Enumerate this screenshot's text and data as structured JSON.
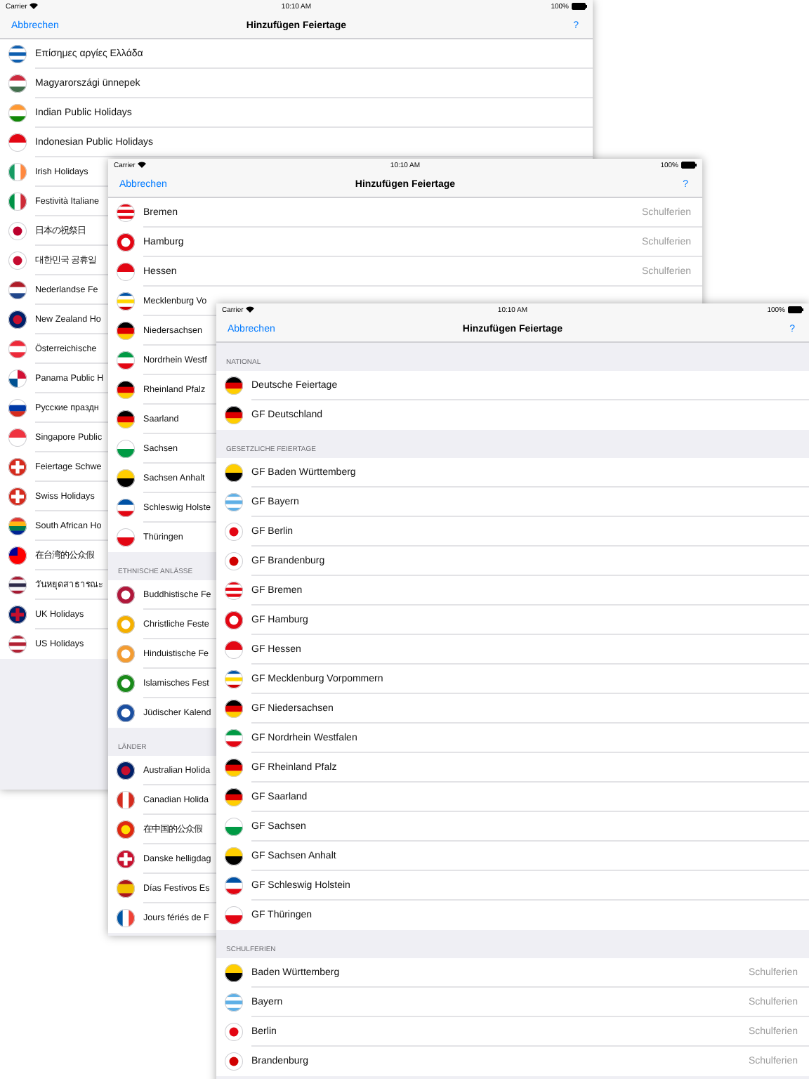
{
  "windows": [
    {
      "status_bar": {
        "carrier": "Carrier",
        "time": "10:10 AM",
        "battery": "100%"
      },
      "nav": {
        "cancel": "Abbrechen",
        "title": "Hinzufügen Feiertage",
        "help": "?"
      },
      "sections": [
        {
          "rows": [
            {
              "label": "Επίσημες αργίες Ελλάδα"
            },
            {
              "label": "Magyarországi ünnepek"
            },
            {
              "label": "Indian Public Holidays"
            },
            {
              "label": "Indonesian Public Holidays"
            },
            {
              "label": "Irish Holidays"
            },
            {
              "label": "Festività Italiane"
            },
            {
              "label": "日本の祝祭日"
            },
            {
              "label": "대한민국 공휴일"
            },
            {
              "label": "Nederlandse Fe"
            },
            {
              "label": "New Zealand Ho"
            },
            {
              "label": "Österreichische"
            },
            {
              "label": "Panama Public H"
            },
            {
              "label": "Русские праздн"
            },
            {
              "label": "Singapore Public"
            },
            {
              "label": "Feiertage Schwe"
            },
            {
              "label": "Swiss Holidays"
            },
            {
              "label": "South African Ho"
            },
            {
              "label": "在台湾的公众假"
            },
            {
              "label": "วันหยุดสาธารณะ"
            },
            {
              "label": "UK Holidays"
            },
            {
              "label": "US Holidays"
            }
          ]
        }
      ]
    },
    {
      "status_bar": {
        "carrier": "Carrier",
        "time": "10:10 AM",
        "battery": "100%"
      },
      "nav": {
        "cancel": "Abbrechen",
        "title": "Hinzufügen Feiertage",
        "help": "?"
      },
      "sections": [
        {
          "rows": [
            {
              "label": "Bremen",
              "detail": "Schulferien"
            },
            {
              "label": "Hamburg",
              "detail": "Schulferien"
            },
            {
              "label": "Hessen",
              "detail": "Schulferien"
            },
            {
              "label": "Mecklenburg Vo"
            },
            {
              "label": "Niedersachsen"
            },
            {
              "label": "Nordrhein Westf"
            },
            {
              "label": "Rheinland Pfalz"
            },
            {
              "label": "Saarland"
            },
            {
              "label": "Sachsen"
            },
            {
              "label": "Sachsen Anhalt"
            },
            {
              "label": "Schleswig Holste"
            },
            {
              "label": "Thüringen"
            }
          ]
        },
        {
          "header": "ETHNISCHE ANLÄSSE",
          "rows": [
            {
              "label": "Buddhistische Fe"
            },
            {
              "label": "Christliche Feste"
            },
            {
              "label": "Hinduistische Fe"
            },
            {
              "label": "Islamisches Fest"
            },
            {
              "label": "Jüdischer Kalend"
            }
          ]
        },
        {
          "header": "LÄNDER",
          "rows": [
            {
              "label": "Australian Holida"
            },
            {
              "label": "Canadian Holida"
            },
            {
              "label": "在中国的公众假"
            },
            {
              "label": "Danske helligdag"
            },
            {
              "label": "Días Festivos Es"
            },
            {
              "label": "Jours fériés de F"
            }
          ]
        }
      ]
    },
    {
      "status_bar": {
        "carrier": "Carrier",
        "time": "10:10 AM",
        "battery": "100%"
      },
      "nav": {
        "cancel": "Abbrechen",
        "title": "Hinzufügen Feiertage",
        "help": "?"
      },
      "sections": [
        {
          "header": "NATIONAL",
          "rows": [
            {
              "label": "Deutsche Feiertage"
            },
            {
              "label": "GF Deutschland"
            }
          ]
        },
        {
          "header": "GESETZLICHE FEIERTAGE",
          "rows": [
            {
              "label": "GF Baden Württemberg"
            },
            {
              "label": "GF Bayern"
            },
            {
              "label": "GF Berlin"
            },
            {
              "label": "GF Brandenburg"
            },
            {
              "label": "GF Bremen"
            },
            {
              "label": "GF Hamburg"
            },
            {
              "label": "GF Hessen"
            },
            {
              "label": "GF Mecklenburg Vorpommern"
            },
            {
              "label": "GF Niedersachsen"
            },
            {
              "label": "GF Nordrhein Westfalen"
            },
            {
              "label": "GF Rheinland Pfalz"
            },
            {
              "label": "GF Saarland"
            },
            {
              "label": "GF Sachsen"
            },
            {
              "label": "GF Sachsen Anhalt"
            },
            {
              "label": "GF Schleswig Holstein"
            },
            {
              "label": "GF Thüringen"
            }
          ]
        },
        {
          "header": "SCHULFERIEN",
          "rows": [
            {
              "label": "Baden Württemberg",
              "detail": "Schulferien"
            },
            {
              "label": "Bayern",
              "detail": "Schulferien"
            },
            {
              "label": "Berlin",
              "detail": "Schulferien"
            },
            {
              "label": "Brandenburg",
              "detail": "Schulferien"
            }
          ]
        }
      ]
    }
  ]
}
